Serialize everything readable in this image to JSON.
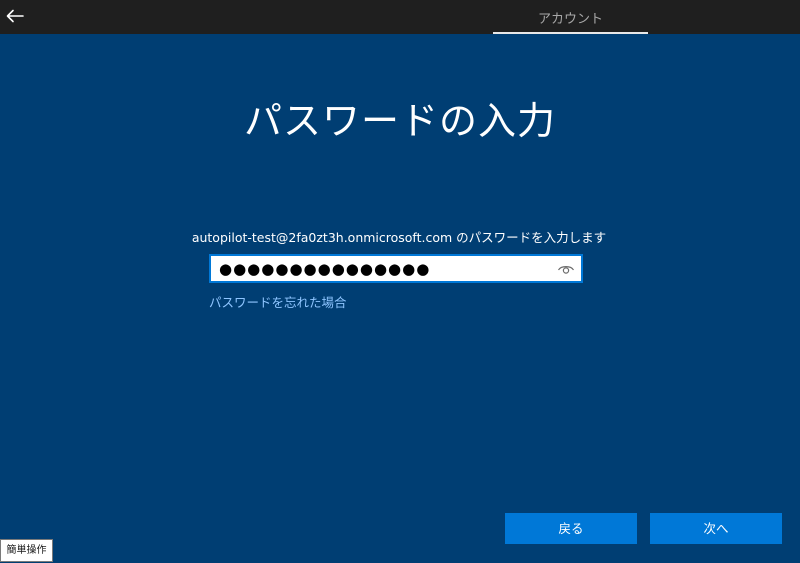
{
  "header": {
    "back_icon": "arrow-left-icon",
    "tab_label": "アカウント"
  },
  "main": {
    "title": "パスワードの入力",
    "instruction": "autopilot-test@2fa0zt3h.onmicrosoft.com のパスワードを入力します",
    "password": {
      "masked_value": "●●●●●●●●●●●●●●●",
      "reveal_icon": "eye-icon"
    },
    "forgot_link": "パスワードを忘れた場合"
  },
  "footer": {
    "back_label": "戻る",
    "next_label": "次へ",
    "ease_of_access_label": "簡単操作"
  },
  "colors": {
    "background": "#003e73",
    "topbar": "#1f1f1f",
    "accent": "#0078d7",
    "link": "#8ec5ff"
  }
}
